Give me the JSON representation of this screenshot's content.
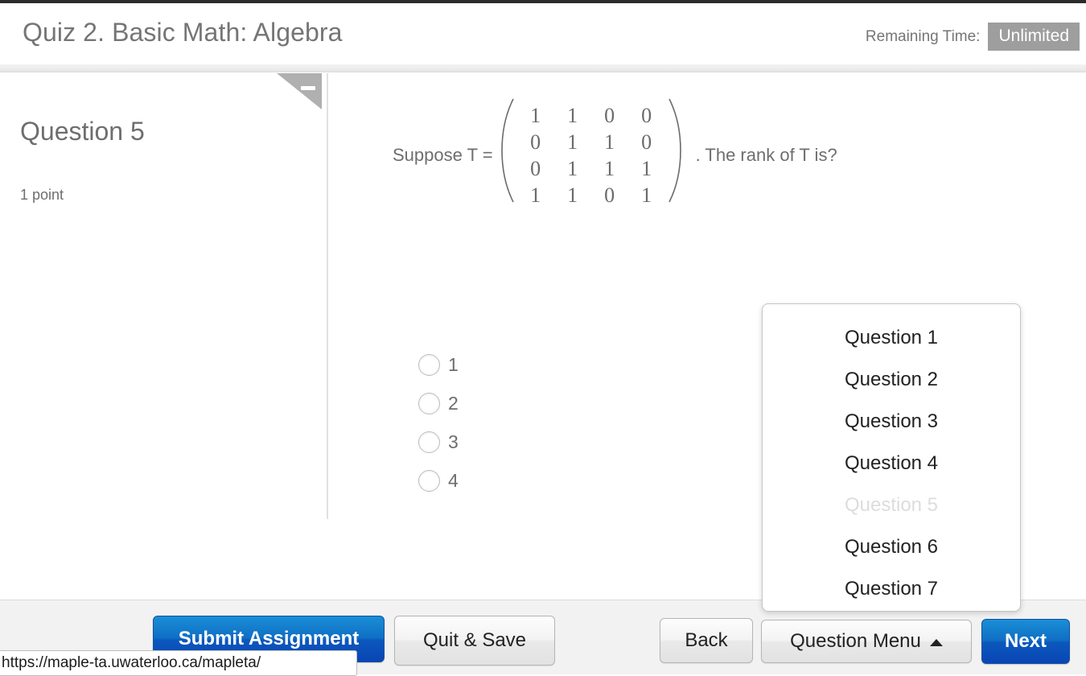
{
  "header": {
    "quiz_title": "Quiz 2. Basic Math: Algebra",
    "time_label": "Remaining Time:",
    "time_value": "Unlimited"
  },
  "sidebar": {
    "question_heading": "Question 5",
    "points": "1 point",
    "collapse_icon": "minus-icon"
  },
  "question": {
    "stem_lead": "Suppose T =",
    "stem_tail": ". The rank of T is?",
    "matrix": [
      [
        "1",
        "1",
        "0",
        "0"
      ],
      [
        "0",
        "1",
        "1",
        "0"
      ],
      [
        "0",
        "1",
        "1",
        "1"
      ],
      [
        "1",
        "1",
        "0",
        "1"
      ]
    ],
    "choices": [
      {
        "label": "1",
        "selected": false
      },
      {
        "label": "2",
        "selected": false
      },
      {
        "label": "3",
        "selected": false
      },
      {
        "label": "4",
        "selected": false
      }
    ]
  },
  "question_menu": {
    "open": true,
    "items": [
      {
        "label": "Question 1",
        "disabled": false
      },
      {
        "label": "Question 2",
        "disabled": false
      },
      {
        "label": "Question 3",
        "disabled": false
      },
      {
        "label": "Question 4",
        "disabled": false
      },
      {
        "label": "Question 5",
        "disabled": true
      },
      {
        "label": "Question 6",
        "disabled": false
      },
      {
        "label": "Question 7",
        "disabled": false
      }
    ]
  },
  "footer": {
    "submit_label": "Submit Assignment",
    "quit_save_label": "Quit & Save",
    "back_label": "Back",
    "question_menu_label": "Question Menu",
    "next_label": "Next",
    "caret_icon": "caret-up-icon"
  },
  "status_bar": {
    "url": "https://maple-ta.uwaterloo.ca/mapleta/"
  },
  "colors": {
    "primary_blue": "#0b58bd",
    "badge_grey": "#9e9e9e",
    "text_grey": "#6e6e6e",
    "footer_bg": "#f2f2f2"
  }
}
